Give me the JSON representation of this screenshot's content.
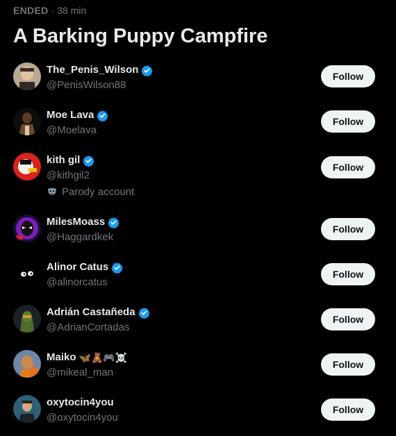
{
  "space": {
    "status": "ENDED",
    "separator": "·",
    "duration": "38 min",
    "title": "A Barking Puppy Campfire"
  },
  "colors": {
    "background": "#000000",
    "verified_badge": "#1d9bf0",
    "button_bg": "#eff3f4",
    "secondary_text": "#71767b"
  },
  "follow_label": "Follow",
  "participants": [
    {
      "name": "The_Penis_Wilson",
      "handle": "@PenisWilson88",
      "verified": true
    },
    {
      "name": "Moe Lava",
      "handle": "@Moelava",
      "verified": true
    },
    {
      "name": "kith gil",
      "handle": "@kithgil2",
      "verified": true,
      "note": "Parody account"
    },
    {
      "name": "MilesMoass",
      "handle": "@Haggardkek",
      "verified": true
    },
    {
      "name": "Alinor Catus",
      "handle": "@alinorcatus",
      "verified": true
    },
    {
      "name": "Adrián Castañeda",
      "handle": "@AdrianCortadas",
      "verified": true
    },
    {
      "name": "Maiko",
      "emojis": "🦋🧸🎮☠️",
      "handle": "@mikeal_man",
      "verified": false
    },
    {
      "name": "oxytocin4you",
      "handle": "@oxytocin4you",
      "verified": false
    }
  ]
}
